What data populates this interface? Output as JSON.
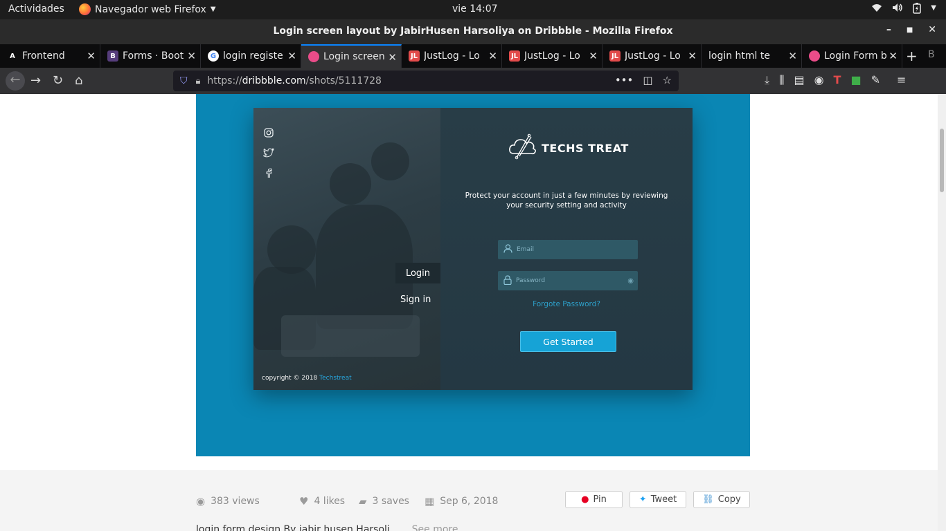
{
  "system": {
    "activities": "Actividades",
    "app_menu": "Navegador web Firefox",
    "clock": "vie 14:07"
  },
  "window": {
    "title": "Login screen layout by JabirHusen Harsoliya on Dribbble - Mozilla Firefox"
  },
  "tabs": [
    {
      "label": "Frontend",
      "icon": "A",
      "icon_color": "#0c0c0d"
    },
    {
      "label": "Forms · Boot",
      "icon": "B",
      "icon_color": "#563d7c"
    },
    {
      "label": "login registe",
      "icon": "G",
      "icon_color": "#ffffff"
    },
    {
      "label": "Login screen",
      "icon": "",
      "icon_color": "#ea4c89"
    },
    {
      "label": "JustLog - Lo",
      "icon": "JL",
      "icon_color": "#e34b4b"
    },
    {
      "label": "JustLog - Lo",
      "icon": "JL",
      "icon_color": "#e34b4b"
    },
    {
      "label": "JustLog - Lo",
      "icon": "JL",
      "icon_color": "#e34b4b"
    },
    {
      "label": "login html temp",
      "icon": "",
      "icon_color": ""
    },
    {
      "label": "Login Form b",
      "icon": "",
      "icon_color": "#ea4c89"
    }
  ],
  "urlbar": {
    "prefix": "https://",
    "domain": "dribbble.com",
    "path": "/shots/5111728"
  },
  "shot": {
    "brand": "TECHS TREAT",
    "subtitle_line1": "Protect  your account in just a few minutes by reviewing",
    "subtitle_line2": "your security setting and activity",
    "email_placeholder": "Email",
    "password_placeholder": "Password",
    "forgot": "Forgote Password?",
    "cta": "Get Started",
    "login_tab": "Login",
    "signin_tab": "Sign in",
    "copyright": "copyright © 2018",
    "copyright_brand": "Techstreat"
  },
  "meta": {
    "views": "383 views",
    "likes": "4 likes",
    "saves": "3 saves",
    "date": "Sep 6, 2018",
    "pin": "Pin",
    "tweet": "Tweet",
    "copy": "Copy",
    "description": "login form design By jabir husen Harsoli...",
    "see_more": "See more"
  },
  "colors": {
    "accent": "#0a84ff",
    "shot_bg": "#0a86b4",
    "cta": "#16a3d6"
  }
}
